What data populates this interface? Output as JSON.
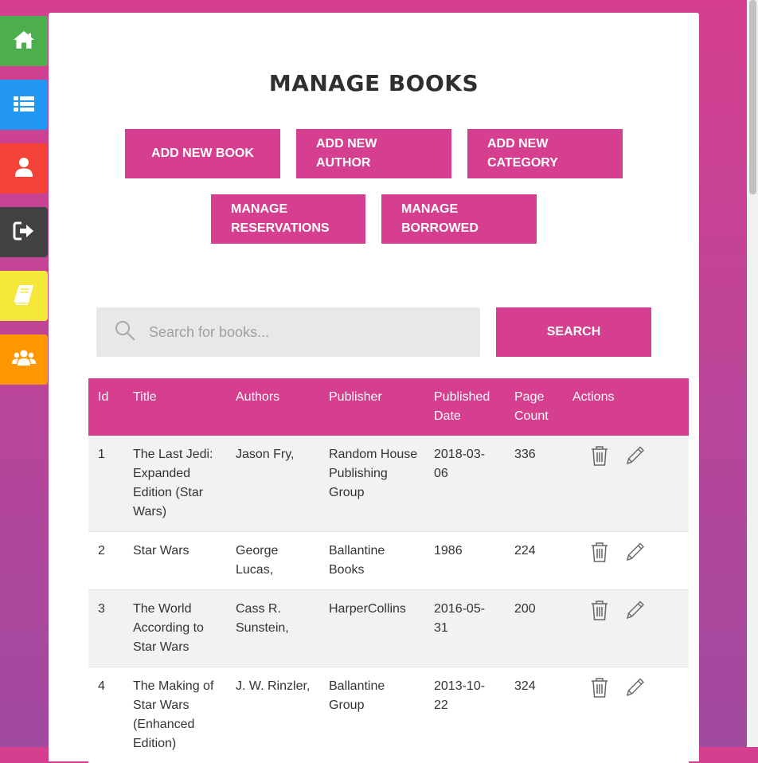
{
  "nav": [
    {
      "name": "home",
      "icon": "home-icon",
      "color": "#4cae4c"
    },
    {
      "name": "list",
      "icon": "list-icon",
      "color": "#2196f3"
    },
    {
      "name": "user",
      "icon": "user-icon",
      "color": "#f44336"
    },
    {
      "name": "logout",
      "icon": "logout-icon",
      "color": "#424242"
    },
    {
      "name": "books",
      "icon": "book-icon",
      "color": "#f5e83a"
    },
    {
      "name": "users",
      "icon": "users-icon",
      "color": "#ff9800"
    }
  ],
  "page": {
    "title": "MANAGE BOOKS"
  },
  "actions": {
    "add_book": "ADD NEW BOOK",
    "add_author": "ADD NEW AUTHOR",
    "add_category": "ADD NEW CATEGORY",
    "manage_reservations": "MANAGE RESERVATIONS",
    "manage_borrowed": "MANAGE BORROWED"
  },
  "search": {
    "placeholder": "Search for books...",
    "value": "",
    "button": "SEARCH"
  },
  "table": {
    "headers": {
      "id": "Id",
      "title": "Title",
      "authors": "Authors",
      "publisher": "Publisher",
      "published_date": "Published Date",
      "page_count": "Page Count",
      "actions": "Actions"
    },
    "rows": [
      {
        "id": "1",
        "title": "The Last Jedi: Expanded Edition (Star Wars)",
        "authors": "Jason Fry,",
        "publisher": "Random House Publishing Group",
        "date": "2018-03-06",
        "pages": "336"
      },
      {
        "id": "2",
        "title": "Star Wars",
        "authors": "George Lucas,",
        "publisher": "Ballantine Books",
        "date": "1986",
        "pages": "224"
      },
      {
        "id": "3",
        "title": "The World According to Star Wars",
        "authors": "Cass R. Sunstein,",
        "publisher": "HarperCollins",
        "date": "2016-05-31",
        "pages": "200"
      },
      {
        "id": "4",
        "title": "The Making of Star Wars (Enhanced Edition)",
        "authors": "J. W. Rinzler,",
        "publisher": "Ballantine Group",
        "date": "2013-10-22",
        "pages": "324"
      }
    ]
  },
  "colors": {
    "accent": "#d63f8f",
    "background_top": "#d63f8f",
    "background_bottom": "#a04aa0"
  }
}
